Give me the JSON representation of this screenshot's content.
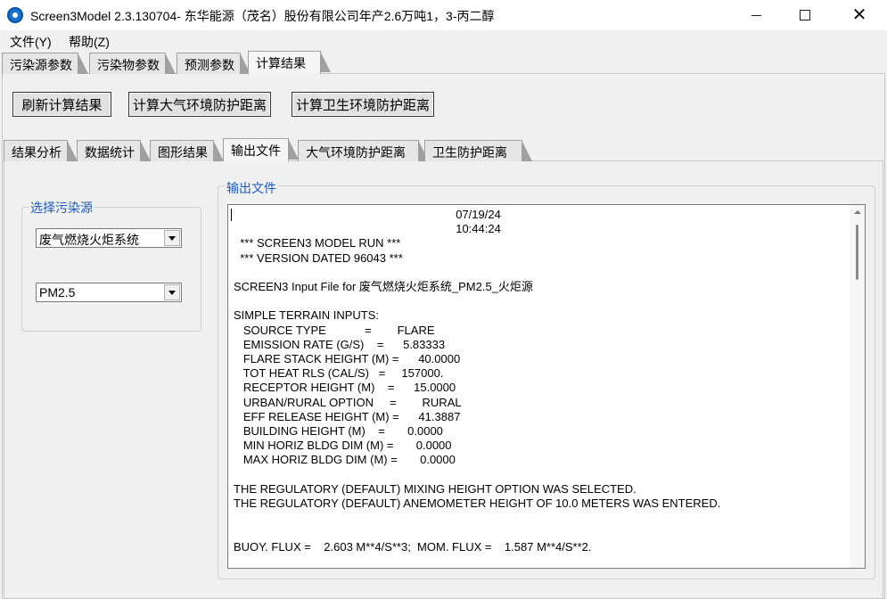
{
  "window": {
    "title": "Screen3Model 2.3.130704- 东华能源（茂名）股份有限公司年产2.6万吨1，3-丙二醇",
    "accent_color": "#1a6fd1"
  },
  "menu": {
    "file": "文件(Y)",
    "help": "帮助(Z)"
  },
  "top_tabs": [
    {
      "label": "污染源参数"
    },
    {
      "label": "污染物参数"
    },
    {
      "label": "预测参数"
    },
    {
      "label": "计算结果",
      "active": true
    }
  ],
  "actions": {
    "refresh": "刷新计算结果",
    "air_distance": "计算大气环境防护距离",
    "health_distance": "计算卫生环境防护距离"
  },
  "sub_tabs": [
    {
      "label": "结果分析"
    },
    {
      "label": "数据统计"
    },
    {
      "label": "图形结果"
    },
    {
      "label": "输出文件",
      "active": true
    },
    {
      "label": "大气环境防护距离"
    },
    {
      "label": "卫生防护距离"
    }
  ],
  "source_group": {
    "legend": "选择污染源",
    "source_value": "废气燃烧火炬系统",
    "pollutant_value": "PM2.5"
  },
  "output_group": {
    "legend": "输出文件",
    "lines": [
      "                                                                     07/19/24",
      "                                                                     10:44:24",
      "  *** SCREEN3 MODEL RUN ***",
      "  *** VERSION DATED 96043 ***",
      "",
      "SCREEN3 Input File for 废气燃烧火炬系统_PM2.5_火炬源",
      "",
      "SIMPLE TERRAIN INPUTS:",
      "   SOURCE TYPE            =        FLARE",
      "   EMISSION RATE (G/S)    =      5.83333",
      "   FLARE STACK HEIGHT (M) =      40.0000",
      "   TOT HEAT RLS (CAL/S)   =     157000.",
      "   RECEPTOR HEIGHT (M)    =      15.0000",
      "   URBAN/RURAL OPTION     =        RURAL",
      "   EFF RELEASE HEIGHT (M) =      41.3887",
      "   BUILDING HEIGHT (M)    =       0.0000",
      "   MIN HORIZ BLDG DIM (M) =       0.0000",
      "   MAX HORIZ BLDG DIM (M) =       0.0000",
      "",
      "THE REGULATORY (DEFAULT) MIXING HEIGHT OPTION WAS SELECTED.",
      "THE REGULATORY (DEFAULT) ANEMOMETER HEIGHT OF 10.0 METERS WAS ENTERED.",
      "",
      "",
      "BUOY. FLUX =    2.603 M**4/S**3;  MOM. FLUX =    1.587 M**4/S**2."
    ]
  }
}
